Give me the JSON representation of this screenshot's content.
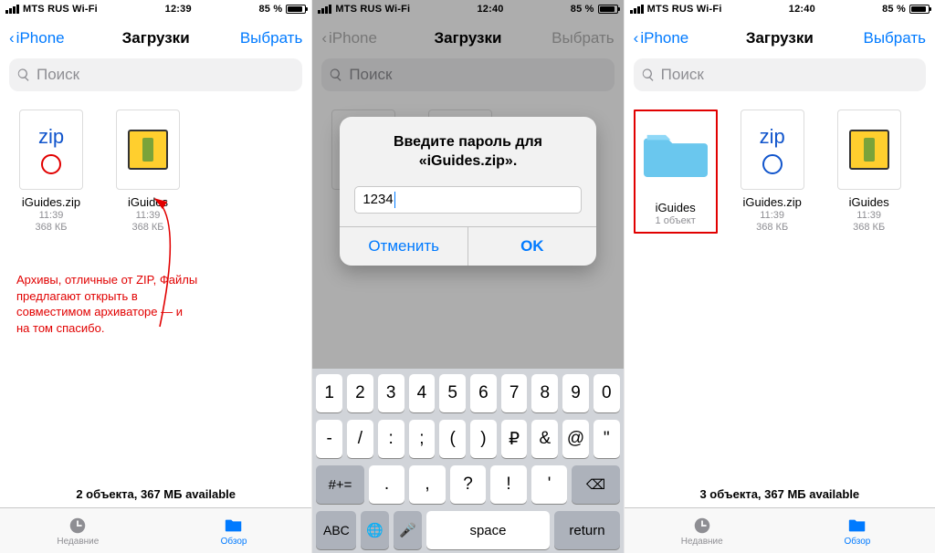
{
  "status": {
    "carrier": "MTS RUS Wi-Fi",
    "time1": "12:39",
    "time2": "12:40",
    "battery": "85 %"
  },
  "nav": {
    "back": "iPhone",
    "title": "Загрузки",
    "select": "Выбрать"
  },
  "search": {
    "placeholder": "Поиск"
  },
  "files1": [
    {
      "name": "iGuides.zip",
      "time": "11:39",
      "size": "368 КБ",
      "kind": "zip"
    },
    {
      "name": "iGuides",
      "time": "11:39",
      "size": "368 КБ",
      "kind": "pic"
    }
  ],
  "files3": [
    {
      "name": "iGuides",
      "meta": "1 объект",
      "kind": "folder"
    },
    {
      "name": "iGuides.zip",
      "time": "11:39",
      "size": "368 КБ",
      "kind": "zip"
    },
    {
      "name": "iGuides",
      "time": "11:39",
      "size": "368 КБ",
      "kind": "pic"
    }
  ],
  "annotation": "Архивы, отличные от ZIP, Файлы предлагают открыть в совместимом архиваторе — и на том спасибо.",
  "footer1": "2 объекта, 367 МБ available",
  "footer3": "3 объекта, 367 МБ available",
  "tabs": {
    "recent": "Недавние",
    "browse": "Обзор"
  },
  "alert": {
    "title": "Введите пароль для «iGuides.zip».",
    "value": "1234",
    "cancel": "Отменить",
    "ok": "OK"
  },
  "kb": {
    "r1": [
      "1",
      "2",
      "3",
      "4",
      "5",
      "6",
      "7",
      "8",
      "9",
      "0"
    ],
    "r2": [
      "-",
      "/",
      ":",
      ";",
      "(",
      ")",
      "₽",
      "&",
      "@",
      "\""
    ],
    "r3_mode": "#+=",
    "r3": [
      ".",
      ",",
      "?",
      "!",
      "'"
    ],
    "r3_bksp": "⌫",
    "r4_abc": "ABC",
    "r4_globe": "🌐",
    "r4_mic": "🎤",
    "r4_space": "space",
    "r4_return": "return"
  }
}
